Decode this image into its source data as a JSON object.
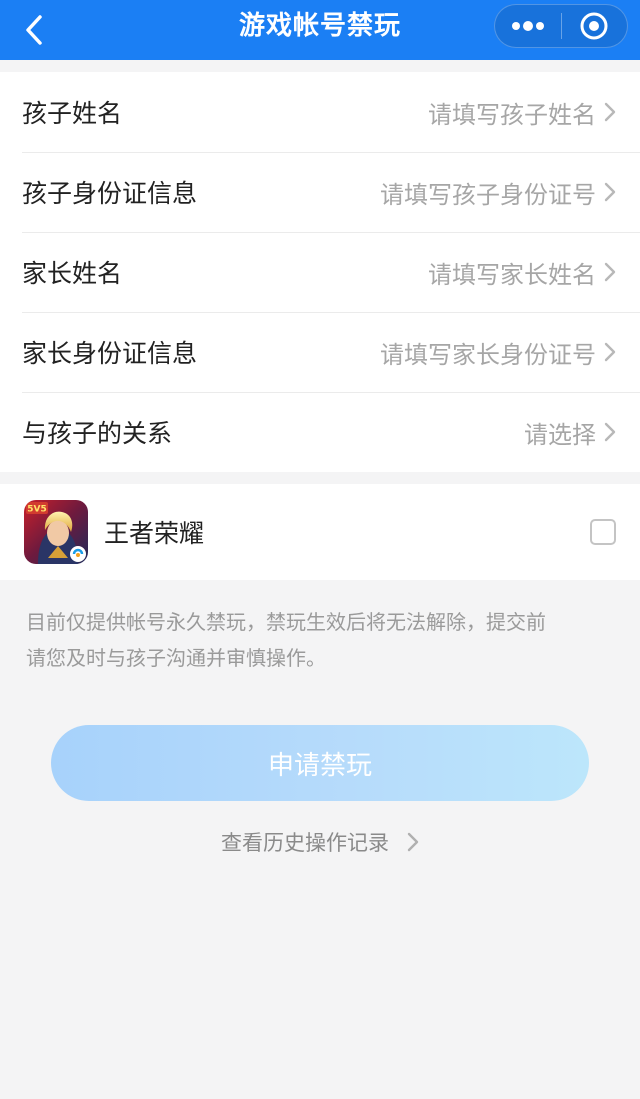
{
  "navbar": {
    "title": "游戏帐号禁玩",
    "back_icon": "chevron-left-icon",
    "more_icon": "more-dots-icon",
    "close_icon": "target-close-icon",
    "background": "#1b7ff4"
  },
  "form": {
    "rows": [
      {
        "label": "孩子姓名",
        "placeholder": "请填写孩子姓名"
      },
      {
        "label": "孩子身份证信息",
        "placeholder": "请填写孩子身份证号"
      },
      {
        "label": "家长姓名",
        "placeholder": "请填写家长姓名"
      },
      {
        "label": "家长身份证信息",
        "placeholder": "请填写家长身份证号"
      },
      {
        "label": "与孩子的关系",
        "placeholder": "请选择"
      }
    ]
  },
  "game": {
    "name": "王者荣耀",
    "icon": "game-app-icon",
    "icon_badge": "5V5",
    "checked": false
  },
  "notice": {
    "line1": "目前仅提供帐号永久禁玩，禁玩生效后将无法解除，提交前",
    "line2": "请您及时与孩子沟通并审慎操作。"
  },
  "apply_button": {
    "label": "申请禁玩",
    "color": "#b3d9fb"
  },
  "history_link": {
    "label": "查看历史操作记录"
  }
}
